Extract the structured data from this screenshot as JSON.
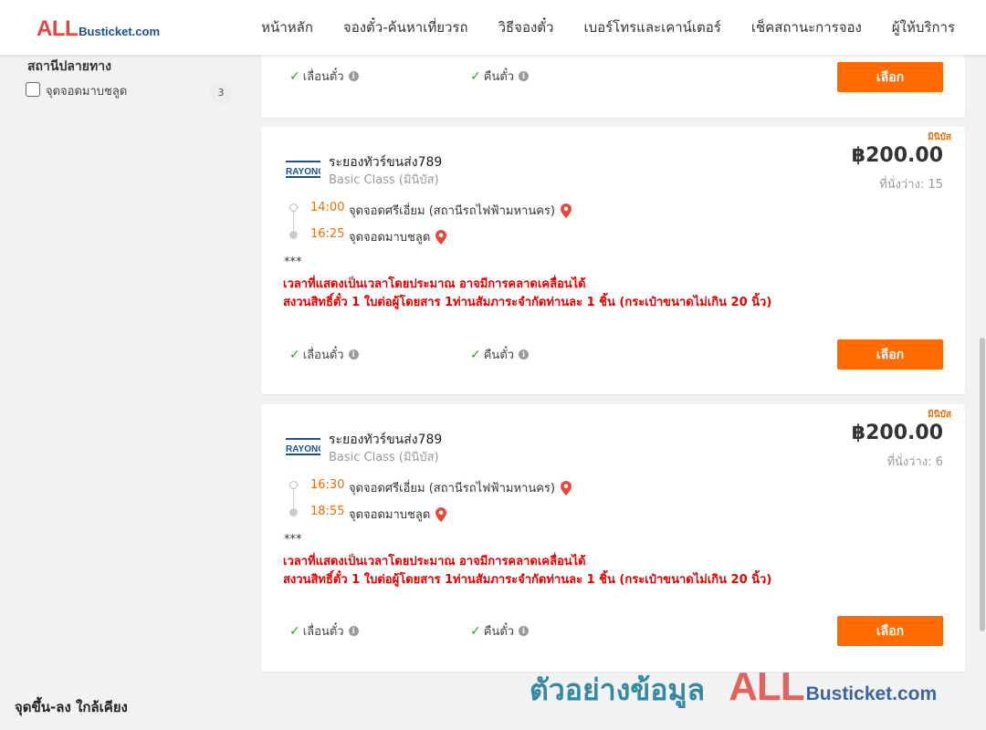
{
  "header": {
    "logo_all": "ALL",
    "logo_rest": "Busticket.com",
    "nav": [
      "หน้าหลัก",
      "จองตั๋ว-ค้นหาเที่ยวรถ",
      "วิธีจองตั๋ว",
      "เบอร์โทรและเคาน์เตอร์",
      "เช็คสถานะการจอง",
      "ผู้ให้บริการ"
    ]
  },
  "sidebar": {
    "filter_title": "สถานีปลายทาง",
    "filter_option": {
      "label": "จุดจอดมาบชลูด",
      "count": "3",
      "checked": false
    },
    "nearby_title": "จุดขึ้น-ลง ใกล้เคียง"
  },
  "common": {
    "feature_1": "เลื่อนตั๋ว",
    "feature_2": "คืนตั๋ว",
    "select_label": "เลือก",
    "info_glyph": "i"
  },
  "trips": [
    {
      "bus_type": "มินิบัส",
      "operator": "ระยองทัวร์ขนส่ง789",
      "class": "Basic Class (มินิบัส)",
      "price": "฿200.00",
      "seats": "ที่นั่งว่าง: 15",
      "depart_time": "14:00",
      "depart_stop": "จุดจอดศรีเอี่ยม (สถานีรถไฟฟ้ามหานคร)",
      "arrive_time": "16:25",
      "arrive_stop": "จุดจอดมาบชลูด",
      "stars": "***",
      "note_1": "เวลาที่แสดงเป็นเวลาโดยประมาณ อาจมีการคลาดเคลื่อนได้",
      "note_2": "สงวนสิทธิ์ตั๋ว 1 ใบต่อผู้โดยสาร 1ท่านสัมภาระจำกัดท่านละ 1 ชิ้น (กระเป๋าขนาดไม่เกิน 20 นิ้ว)"
    },
    {
      "bus_type": "มินิบัส",
      "operator": "ระยองทัวร์ขนส่ง789",
      "class": "Basic Class (มินิบัส)",
      "price": "฿200.00",
      "seats": "ที่นั่งว่าง: 6",
      "depart_time": "16:30",
      "depart_stop": "จุดจอดศรีเอี่ยม (สถานีรถไฟฟ้ามหานคร)",
      "arrive_time": "18:55",
      "arrive_stop": "จุดจอดมาบชลูด",
      "stars": "***",
      "note_1": "เวลาที่แสดงเป็นเวลาโดยประมาณ อาจมีการคลาดเคลื่อนได้",
      "note_2": "สงวนสิทธิ์ตั๋ว 1 ใบต่อผู้โดยสาร 1ท่านสัมภาระจำกัดท่านละ 1 ชิ้น (กระเป๋าขนาดไม่เกิน 20 นิ้ว)"
    }
  ],
  "operator_logo_text": "RAYONG",
  "watermark": {
    "thai": "ตัวอย่างข้อมูล",
    "all": "ALL",
    "rest": "Busticket.com"
  },
  "colors": {
    "accent": "#ff6b00",
    "time": "#ef6c00",
    "note": "#e60000",
    "check": "#2e9d2e"
  },
  "icons": [
    "check-icon",
    "info-icon",
    "map-pin-icon",
    "operator-logo"
  ]
}
